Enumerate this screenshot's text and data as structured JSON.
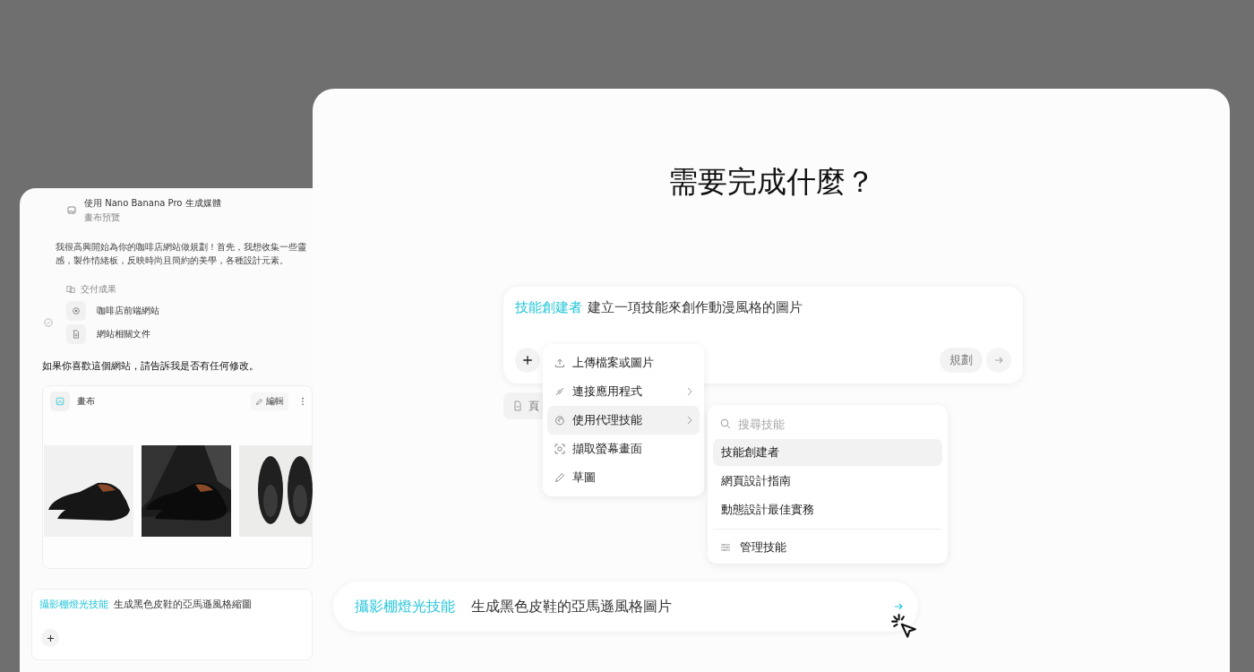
{
  "left_panel": {
    "media_task": {
      "title": "使用 Nano Banana Pro 生成媒體",
      "subtitle": "畫布預覽"
    },
    "message": "我很高興開始為你的咖啡店網站做規劃！首先，我想收集一些靈感，製作情緒板，反映時尚且簡約的美學，各種設計元素。",
    "deliverables": {
      "heading": "交付成果",
      "items": [
        {
          "label": "咖啡店前端網站",
          "kind": "website"
        },
        {
          "label": "網站相關文件",
          "kind": "document"
        }
      ]
    },
    "follow_up": "如果你喜歡這個網站，請告訴我是否有任何修改。",
    "canvas": {
      "title": "畫布",
      "edit_button": "編輯"
    },
    "composer": {
      "skill": "攝影棚燈光技能",
      "text": "生成黑色皮鞋的亞馬遜風格縮圖"
    }
  },
  "main_panel": {
    "title": "需要完成什麼？",
    "composer": {
      "skill": "技能創建者",
      "text": "建立一項技能來創作動漫風格的圖片",
      "plan_button": "規劃"
    },
    "attachment_chip": "頁",
    "add_menu": {
      "items": [
        {
          "label": "上傳檔案或圖片",
          "kind": "upload",
          "has_submenu": false,
          "selected": false
        },
        {
          "label": "連接應用程式",
          "kind": "connect",
          "has_submenu": true,
          "selected": false
        },
        {
          "label": "使用代理技能",
          "kind": "skill",
          "has_submenu": true,
          "selected": true
        },
        {
          "label": "擷取螢幕畫面",
          "kind": "screenshot",
          "has_submenu": false,
          "selected": false
        },
        {
          "label": "草圖",
          "kind": "sketch",
          "has_submenu": false,
          "selected": false
        }
      ]
    },
    "skills_menu": {
      "search": {
        "placeholder": "搜尋技能"
      },
      "items": [
        {
          "label": "技能創建者",
          "selected": true
        },
        {
          "label": "網頁設計指南",
          "selected": false
        },
        {
          "label": "動態設計最佳實務",
          "selected": false
        }
      ],
      "manage": "管理技能"
    },
    "suggestion": {
      "skill": "攝影棚燈光技能",
      "text": "生成黑色皮鞋的亞馬遜風格圖片"
    }
  }
}
